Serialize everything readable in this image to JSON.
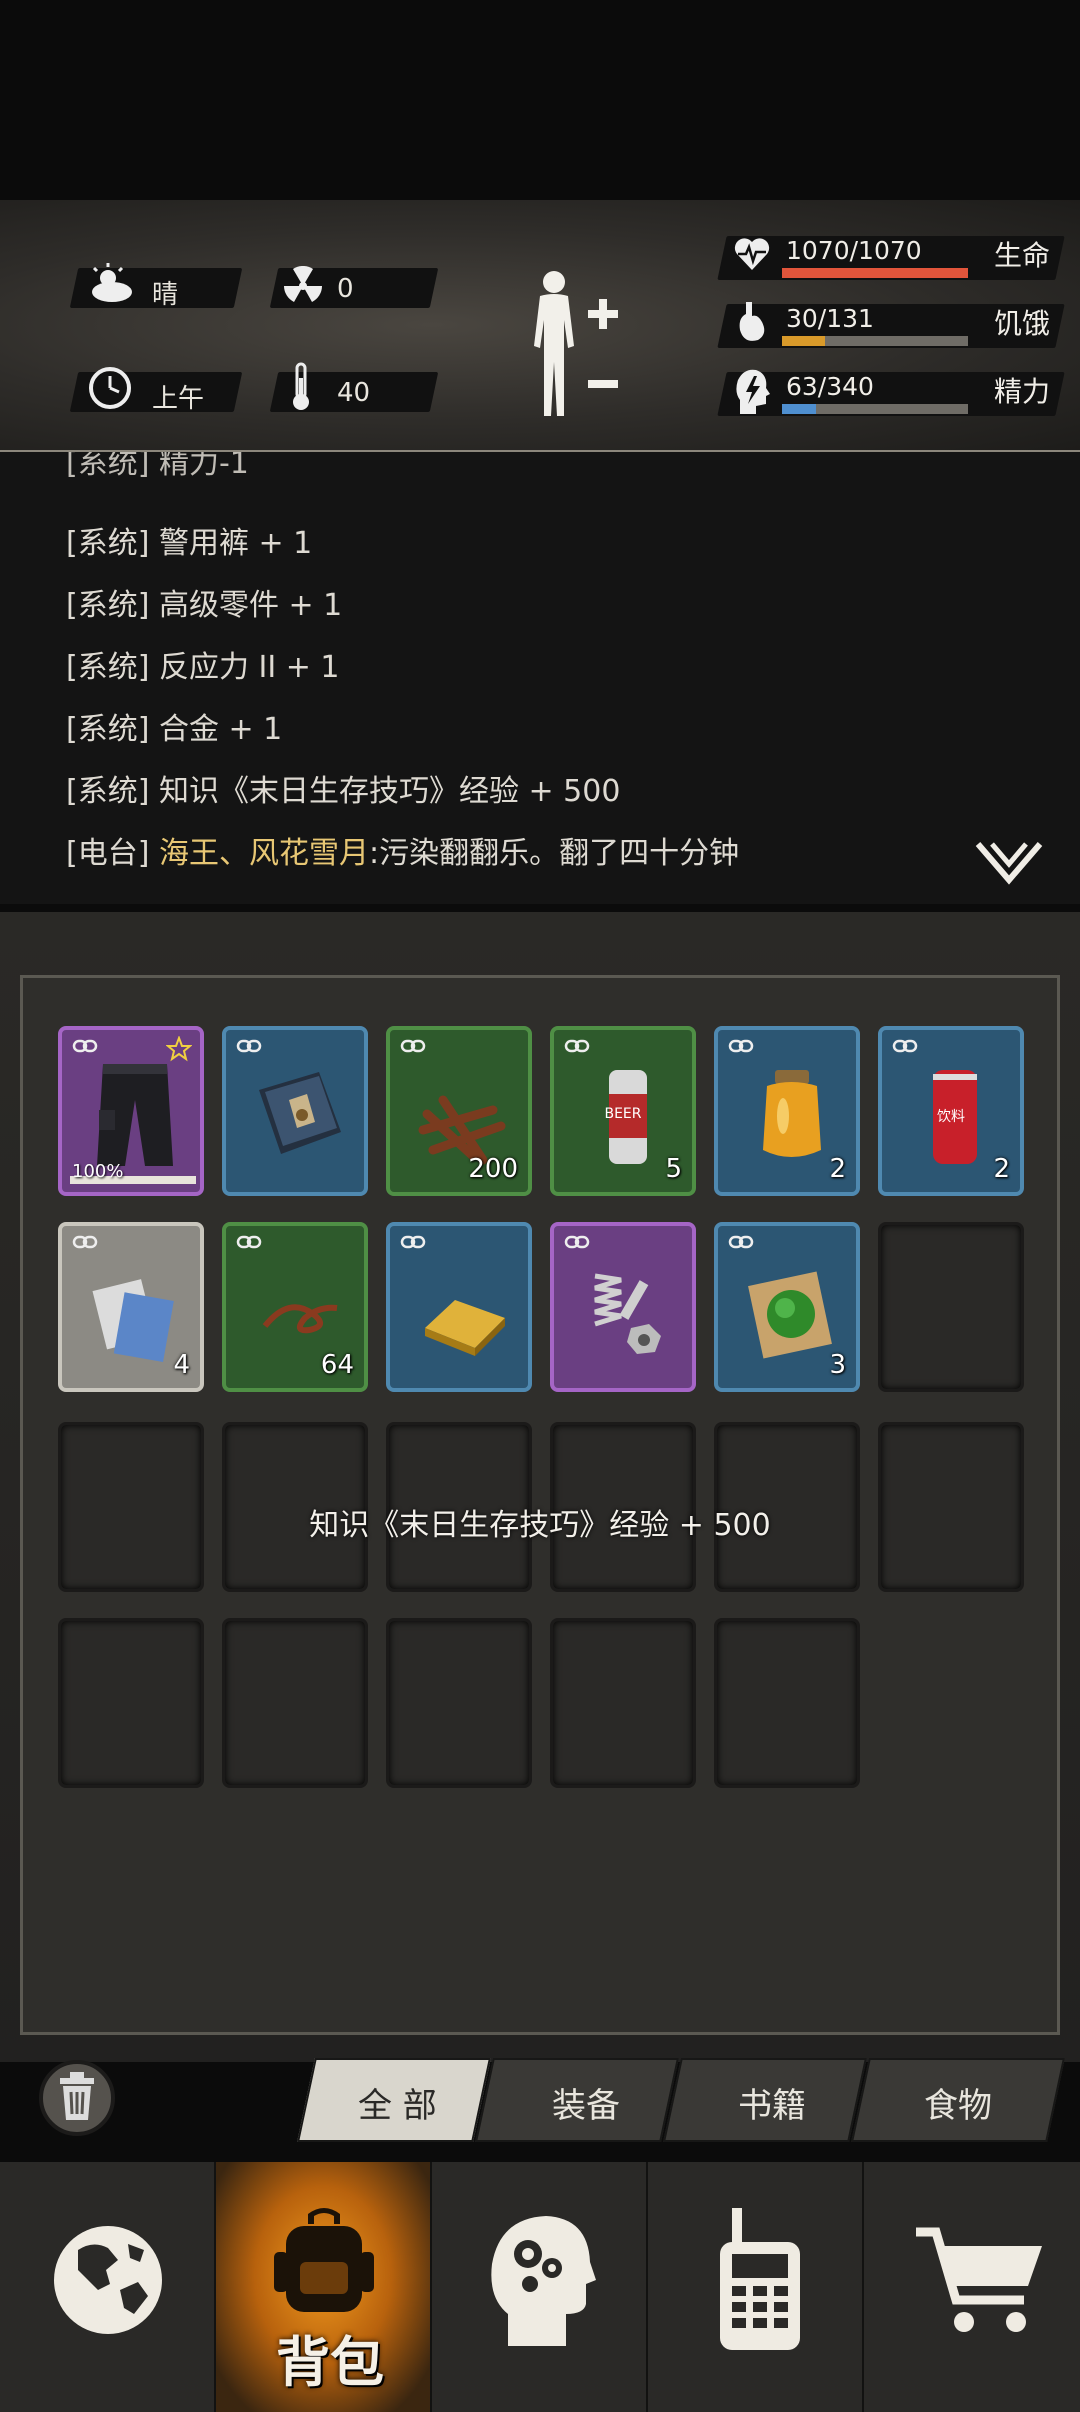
{
  "status": {
    "weather": {
      "label": "晴",
      "icon": "sun-cloud-icon"
    },
    "radiation": {
      "value": "0",
      "icon": "radiation-icon"
    },
    "time": {
      "label": "上午",
      "icon": "clock-icon"
    },
    "temperature": {
      "value": "40",
      "icon": "thermometer-icon"
    },
    "body": {
      "icon": "human-body-icon",
      "plus": "+",
      "minus": "−"
    }
  },
  "stats": [
    {
      "key": "health",
      "value": "1070/1070",
      "label": "生命",
      "fraction": 1.0,
      "color": "#e2553b",
      "icon": "heart-pulse-icon"
    },
    {
      "key": "hunger",
      "value": "30/131",
      "label": "饥饿",
      "fraction": 0.229,
      "color": "#d99a2a",
      "icon": "stomach-icon"
    },
    {
      "key": "energy",
      "value": "63/340",
      "label": "精力",
      "fraction": 0.185,
      "color": "#4f8fd0",
      "icon": "head-energy-icon"
    }
  ],
  "log": {
    "partial_line": "[系统] 精力-1",
    "lines": [
      {
        "tag": "[系统]",
        "text": "警用裤 + 1"
      },
      {
        "tag": "[系统]",
        "text": "高级零件 + 1"
      },
      {
        "tag": "[系统]",
        "text": "反应力 II + 1"
      },
      {
        "tag": "[系统]",
        "text": "合金 + 1"
      },
      {
        "tag": "[系统]",
        "text": "知识《末日生存技巧》经验 + 500"
      }
    ],
    "radio": {
      "tag": "[电台]",
      "speaker": "海王、风花雪月",
      "text": ":污染翻翻乐。翻了四十分钟"
    },
    "expand_icon": "double-chevron-down-icon"
  },
  "inventory": {
    "items": [
      {
        "name": "警用裤",
        "rarity": "purple",
        "count": "",
        "durability": "100%",
        "favorite": true,
        "icon": "pants-icon"
      },
      {
        "name": "书籍",
        "rarity": "blue",
        "count": "",
        "icon": "book-icon"
      },
      {
        "name": "木棍",
        "rarity": "green",
        "count": "200",
        "icon": "sticks-icon"
      },
      {
        "name": "啤酒",
        "rarity": "green",
        "count": "5",
        "can_text": "BEER",
        "icon": "beer-can-icon"
      },
      {
        "name": "蜂蜜",
        "rarity": "blue",
        "count": "2",
        "icon": "honey-jar-icon"
      },
      {
        "name": "饮料",
        "rarity": "blue",
        "count": "2",
        "can_text": "饮料",
        "icon": "soda-can-icon"
      },
      {
        "name": "纸",
        "rarity": "grey",
        "count": "4",
        "icon": "paper-icon"
      },
      {
        "name": "绳子",
        "rarity": "green",
        "count": "64",
        "icon": "rope-icon"
      },
      {
        "name": "金条",
        "rarity": "blue",
        "count": "",
        "icon": "gold-bar-icon"
      },
      {
        "name": "高级零件",
        "rarity": "purple",
        "count": "",
        "icon": "parts-icon"
      },
      {
        "name": "药膏",
        "rarity": "blue",
        "count": "3",
        "icon": "herb-poultice-icon"
      }
    ],
    "empty_slots": 12,
    "toast": "知识《末日生存技巧》经验 + 500"
  },
  "tabs": [
    {
      "label": "全 部",
      "active": true
    },
    {
      "label": "装备",
      "active": false
    },
    {
      "label": "书籍",
      "active": false
    },
    {
      "label": "食物",
      "active": false
    }
  ],
  "trash_icon": "trash-icon",
  "nav": [
    {
      "icon": "globe-icon",
      "active": false
    },
    {
      "icon": "backpack-icon",
      "label": "背包",
      "active": true
    },
    {
      "icon": "brain-head-icon",
      "active": false
    },
    {
      "icon": "walkie-talkie-icon",
      "active": false
    },
    {
      "icon": "shopping-cart-icon",
      "active": false
    }
  ]
}
